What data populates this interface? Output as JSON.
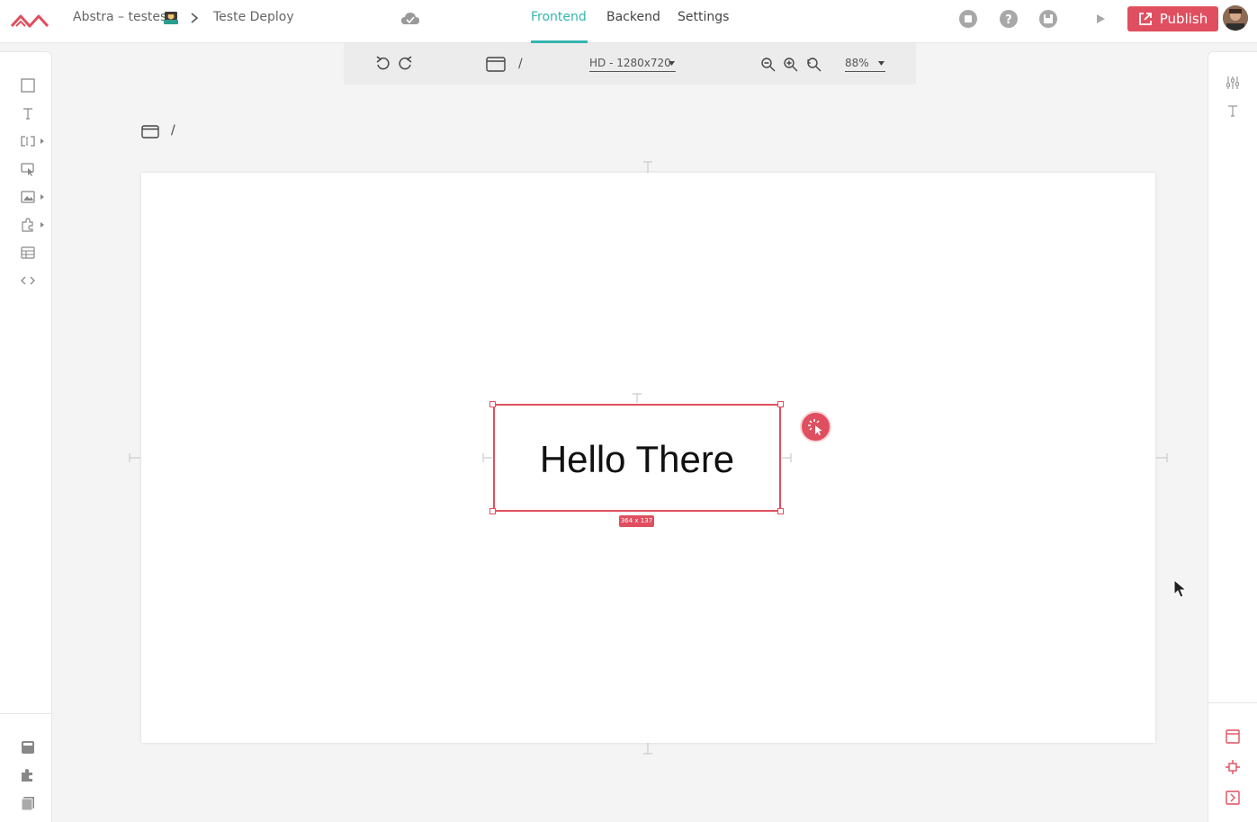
{
  "header": {
    "project_name": "Abstra – testes",
    "page_name": "Teste Deploy",
    "tabs": [
      {
        "label": "Frontend",
        "active": true
      },
      {
        "label": "Backend",
        "active": false
      },
      {
        "label": "Settings",
        "active": false
      }
    ],
    "publish_label": "Publish",
    "accent_color": "#35b5ae",
    "brand_color": "#e04f5f",
    "icons": [
      "abstra-logo-icon",
      "technologist-emoji-icon",
      "chevron-right-icon",
      "cloud-saved-icon",
      "stop-icon",
      "help-icon",
      "save-icon",
      "play-icon",
      "external-link-icon",
      "avatar"
    ]
  },
  "toolbar": {
    "path": "/",
    "resolution": "HD - 1280x720",
    "zoom": "88%",
    "icons": [
      "undo-icon",
      "redo-icon",
      "window-icon",
      "zoom-out-icon",
      "zoom-in-icon",
      "zoom-reset-icon"
    ]
  },
  "left_sidebar": {
    "icons": [
      "container-icon",
      "text-icon",
      "input-icon",
      "button-icon",
      "image-icon",
      "plugin-icon",
      "table-icon",
      "code-icon",
      "page-icon",
      "widgets-icon",
      "pages-icon"
    ]
  },
  "right_sidebar": {
    "icons": [
      "properties-icon",
      "typography-icon",
      "window-icon",
      "move-icon",
      "collapse-icon"
    ]
  },
  "canvas": {
    "page_path": "/",
    "text_widget": "Hello There",
    "selection_size": "364 x 137"
  }
}
